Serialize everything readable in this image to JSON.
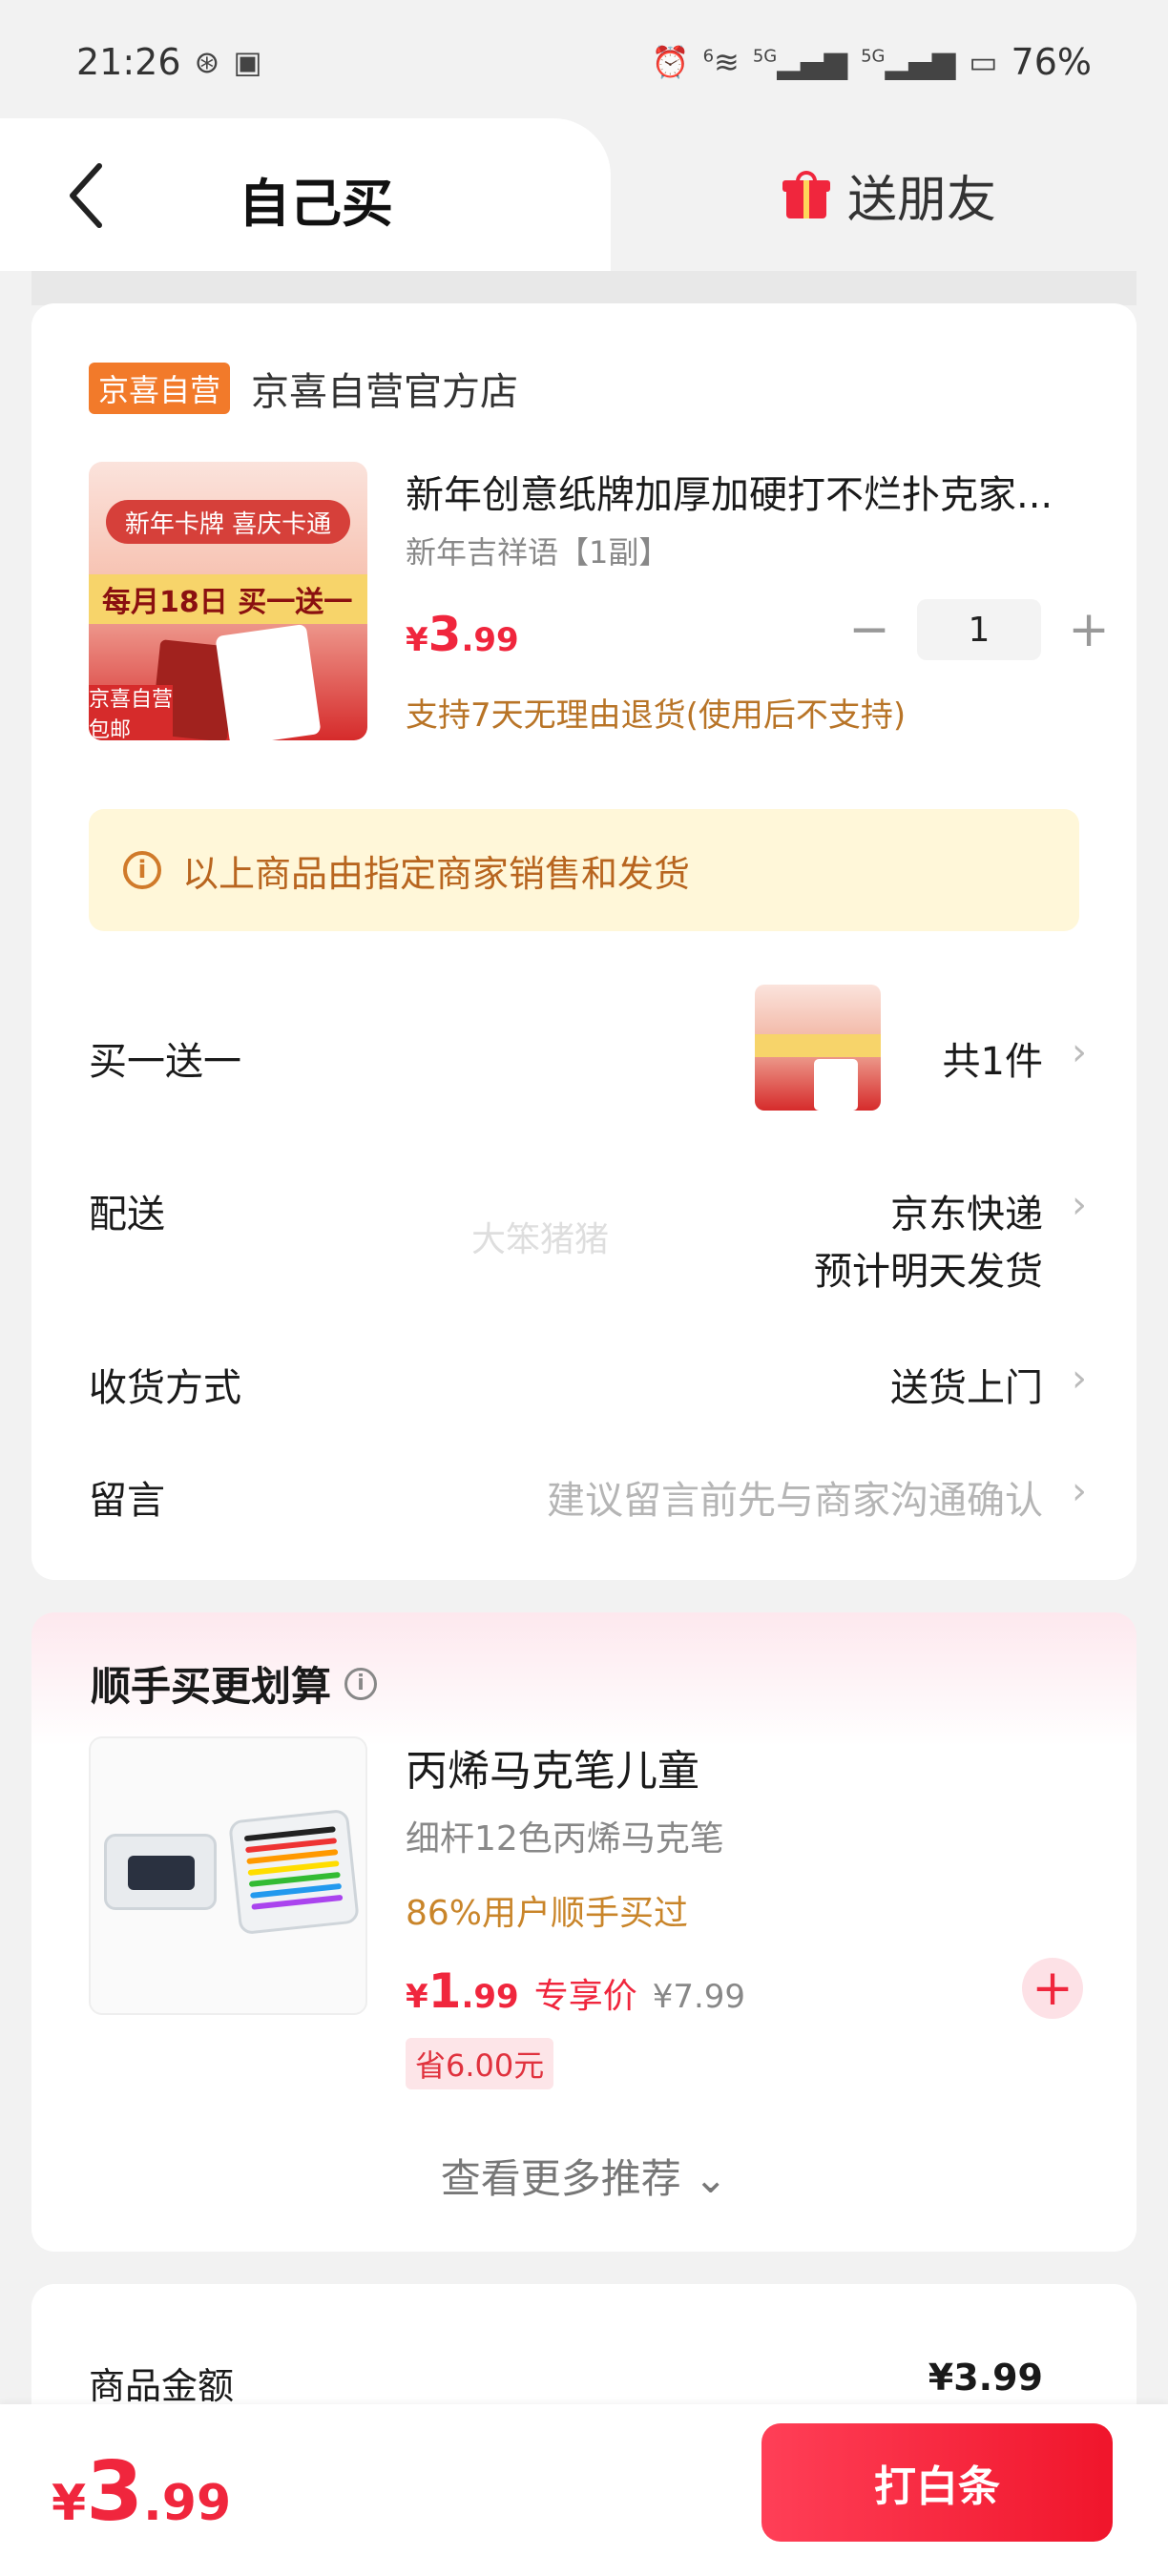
{
  "status_bar": {
    "time": "21:26",
    "battery": "76%",
    "net1": "5G",
    "net2": "5G",
    "wifi": "6"
  },
  "tabs": {
    "self": "自己买",
    "friend": "送朋友"
  },
  "shop": {
    "badge": "京喜自营",
    "name": "京喜自营官方店"
  },
  "product": {
    "title": "新年创意纸牌加厚加硬打不烂扑克家...",
    "variant": "新年吉祥语【1副】",
    "price": {
      "currency": "¥",
      "int": "3",
      "dec": ".99"
    },
    "quantity": "1",
    "minus": "−",
    "plus": "+",
    "return_note": "支持7天无理由退货(使用后不支持)",
    "image_text": {
      "top": "新年卡牌 喜庆卡通",
      "banner": "每月18日 买一送一",
      "tag": "京喜自营包邮"
    }
  },
  "notice": {
    "icon": "info-icon",
    "text": "以上商品由指定商家销售和发货"
  },
  "rows": {
    "bogo": {
      "label": "买一送一",
      "value": "共1件"
    },
    "delivery": {
      "label": "配送",
      "value": "京东快递",
      "sub": "预计明天发货"
    },
    "receive": {
      "label": "收货方式",
      "value": "送货上门"
    },
    "message": {
      "label": "留言",
      "placeholder": "建议留言前先与商家沟通确认"
    },
    "chevron": "›"
  },
  "watermark": "大笨猪猪",
  "recommend": {
    "title": "顺手买更划算",
    "item": {
      "name": "丙烯马克笔儿童",
      "desc": "细杆12色丙烯马克笔",
      "popularity": "86%用户顺手买过",
      "price": {
        "currency": "¥",
        "int": "1",
        "dec": ".99"
      },
      "exclusive": "专享价",
      "original": "¥7.99",
      "save": "省6.00元",
      "add": "+"
    },
    "more": "查看更多推荐 ⌄"
  },
  "summary": {
    "label": "商品金额",
    "value": "¥3.99"
  },
  "bottom": {
    "total": {
      "currency": "¥",
      "int": "3",
      "dec": ".99"
    },
    "pay_button": "打白条"
  },
  "colors": {
    "accent": "#f0263d",
    "badge": "#f27a2a",
    "notice_bg": "#fff7d9",
    "notice_text": "#b8651f",
    "return_text": "#b87427"
  }
}
